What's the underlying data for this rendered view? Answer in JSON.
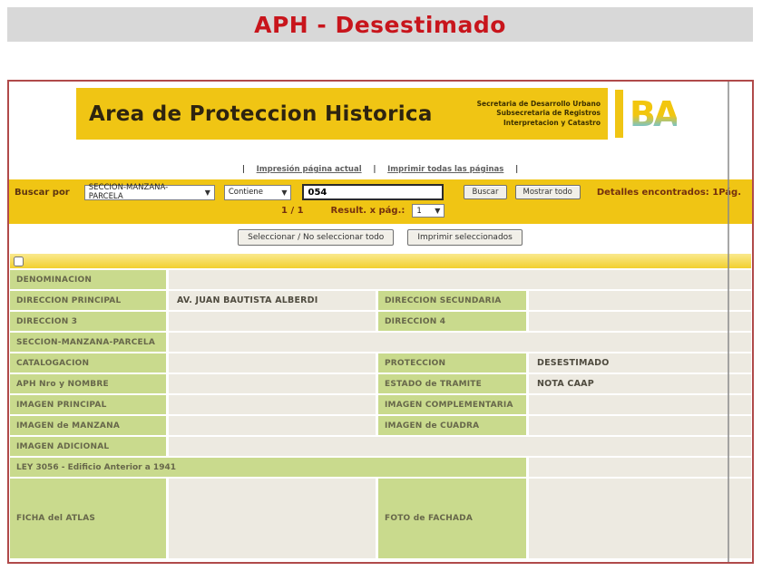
{
  "banner": {
    "title": "APH - Desestimado"
  },
  "page": {
    "header": {
      "title": "Area de Proteccion Historica",
      "org_line1": "Secretaria de Desarrollo Urbano",
      "org_line2": "Subsecretaria de Registros",
      "org_line3": "Interpretacion y Catastro",
      "logo_text": "BA"
    },
    "print_links": {
      "separator": "|",
      "current_page": "Impresión página actual",
      "all_pages": "Imprimir todas las páginas"
    },
    "search": {
      "label": "Buscar por",
      "field_select": "SECCION-MANZANA-PARCELA",
      "operator_select": "Contiene",
      "query": "054",
      "search_button": "Buscar",
      "show_all_button": "Mostrar todo",
      "details_found": "Detalles encontrados: 1",
      "page_abbr": "Pág.",
      "page_indicator": "1 / 1",
      "results_per_page_label": "Result. x pág.:",
      "results_per_page": "1",
      "chevron": "▼"
    },
    "actions": {
      "toggle_select_button": "Seleccionar / No seleccionar todo",
      "print_selected_button": "Imprimir seleccionados"
    },
    "record": {
      "denominacion_label": "DENOMINACION",
      "direccion_principal_label": "DIRECCION PRINCIPAL",
      "direccion_principal_value": "AV. JUAN BAUTISTA ALBERDI",
      "direccion_secundaria_label": "DIRECCION SECUNDARIA",
      "direccion_3_label": "DIRECCION 3",
      "direccion_4_label": "DIRECCION 4",
      "seccion_manzana_parcela_label": "SECCION-MANZANA-PARCELA",
      "catalogacion_label": "CATALOGACION",
      "proteccion_label": "PROTECCION",
      "proteccion_value": "DESESTIMADO",
      "aph_nro_nombre_label": "APH Nro y NOMBRE",
      "estado_tramite_label": "ESTADO de TRAMITE",
      "estado_tramite_value": "NOTA CAAP",
      "imagen_principal_label": "IMAGEN PRINCIPAL",
      "imagen_complementaria_label": "IMAGEN COMPLEMENTARIA",
      "imagen_manzana_label": "IMAGEN de MANZANA",
      "imagen_cuadra_label": "IMAGEN de CUADRA",
      "imagen_adicional_label": "IMAGEN ADICIONAL",
      "ley_3056_label": "LEY 3056 - Edificio Anterior a 1941",
      "ficha_atlas_label": "FICHA del ATLAS",
      "foto_fachada_label": "FOTO de FACHADA"
    }
  },
  "colors": {
    "banner_bg": "#d8d8d8",
    "title_red": "#c8151c",
    "frame_border": "#b04a4a",
    "golden_yellow": "#f0c514",
    "checkbox_row_yellow": "#f5d945",
    "cell_green": "#c9da8d",
    "cell_light": "#edeae1",
    "logo_blue": "#6cc3dd"
  }
}
